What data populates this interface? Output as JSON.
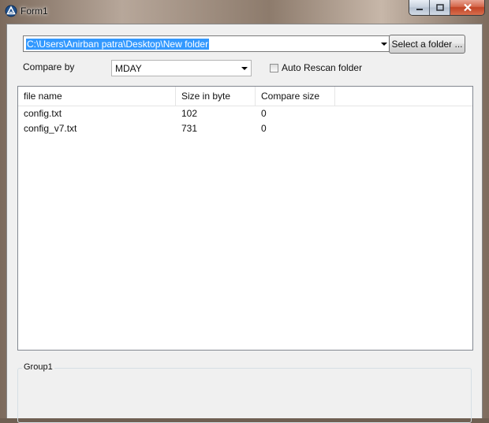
{
  "window": {
    "title": "Form1"
  },
  "path_combo": {
    "value": "C:\\Users\\Anirban patra\\Desktop\\New folder"
  },
  "select_button": {
    "label": "Select a folder ..."
  },
  "compare": {
    "label": "Compare by",
    "selected": "MDAY"
  },
  "auto_rescan": {
    "label": "Auto Rescan folder",
    "checked": false
  },
  "list": {
    "columns": [
      "file name",
      "Size in byte",
      "Compare size"
    ],
    "rows": [
      [
        "config.txt",
        "102",
        "0"
      ],
      [
        "config_v7.txt",
        "731",
        "0"
      ]
    ]
  },
  "group": {
    "label": "Group1"
  }
}
